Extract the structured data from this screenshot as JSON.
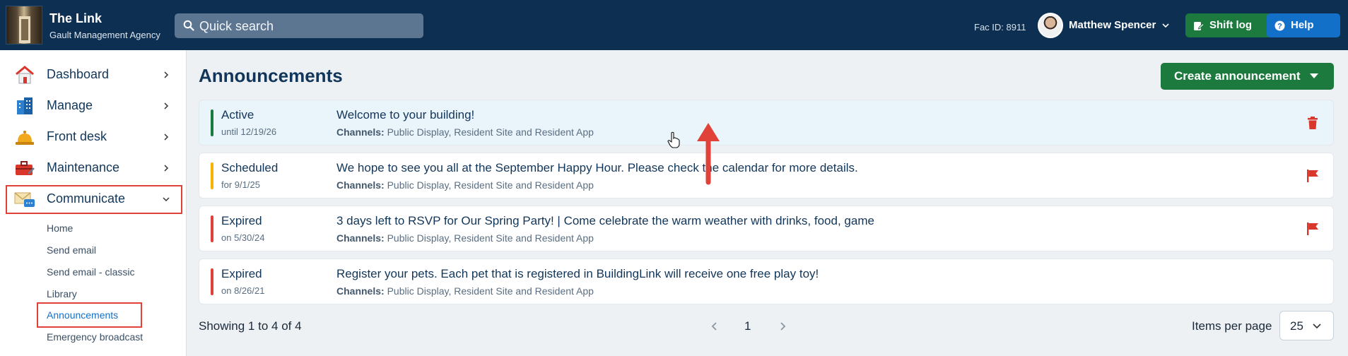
{
  "header": {
    "app_title": "The Link",
    "app_subtitle": "Gault Management Agency",
    "search_placeholder": "Quick search",
    "fac_id": "Fac ID: 8911",
    "user_name": "Matthew Spencer",
    "shift_log_label": "Shift log",
    "help_label": "Help",
    "colors": {
      "bar": "#0d2f52",
      "shift": "#1d7a3e",
      "help": "#1270c9"
    }
  },
  "sidebar": {
    "items": [
      {
        "label": "Dashboard",
        "icon": "house-icon"
      },
      {
        "label": "Manage",
        "icon": "building-icon"
      },
      {
        "label": "Front desk",
        "icon": "bell-icon"
      },
      {
        "label": "Maintenance",
        "icon": "toolbox-icon"
      },
      {
        "label": "Communicate",
        "icon": "envelope-chat-icon",
        "expanded": true
      }
    ],
    "sub_items": [
      "Home",
      "Send email",
      "Send email - classic",
      "Library",
      "Announcements",
      "Emergency broadcast"
    ],
    "active_sub_item": "Announcements"
  },
  "main": {
    "title": "Announcements",
    "create_button_label": "Create announcement",
    "channels_label": "Channels:",
    "announcements": [
      {
        "status": "Active",
        "date": "until 12/19/26",
        "title": "Welcome to your building!",
        "channels": "Public Display, Resident Site and Resident App",
        "status_color": "#1d7a3e",
        "action_icon": "trash-icon"
      },
      {
        "status": "Scheduled",
        "date": "for 9/1/25",
        "title": "We hope to see you all at the September Happy Hour. Please check the calendar for more details.",
        "channels": "Public Display, Resident Site and Resident App",
        "status_color": "#f5b400",
        "action_icon": "flag-icon"
      },
      {
        "status": "Expired",
        "date": "on 5/30/24",
        "title": "3 days left to RSVP for Our Spring Party! | Come celebrate the warm weather with drinks, food, game",
        "channels": "Public Display, Resident Site and Resident App",
        "status_color": "#e0423a",
        "action_icon": "flag-icon"
      },
      {
        "status": "Expired",
        "date": "on 8/26/21",
        "title": "Register your pets. Each pet that is registered in BuildingLink will receive one free play toy!",
        "channels": "Public Display, Resident Site and Resident App",
        "status_color": "#e0423a",
        "action_icon": ""
      }
    ],
    "pagination": {
      "showing": "Showing 1 to 4 of 4",
      "current_page": "1",
      "items_per_page_label": "Items per page",
      "items_per_page_value": "25"
    }
  },
  "annotation_color": "#e0423a"
}
